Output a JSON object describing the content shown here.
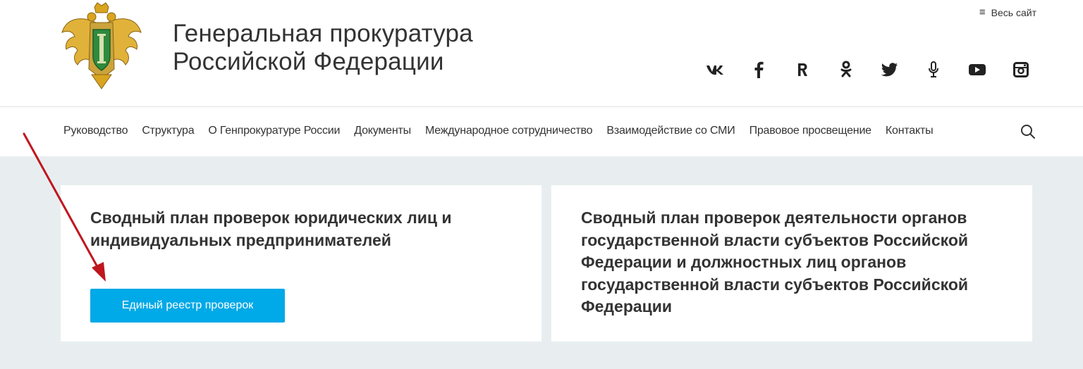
{
  "header": {
    "title_line1": "Генеральная прокуратура",
    "title_line2": "Российской Федерации",
    "all_site_label": "Весь сайт",
    "all_site_icon": "menu-icon"
  },
  "social": [
    {
      "name": "vk",
      "glyph": "VK"
    },
    {
      "name": "facebook",
      "glyph": "f"
    },
    {
      "name": "rutube",
      "glyph": "R"
    },
    {
      "name": "odnoklassniki",
      "glyph": "ok"
    },
    {
      "name": "twitter",
      "glyph": "bird"
    },
    {
      "name": "podcast",
      "glyph": "mic"
    },
    {
      "name": "youtube",
      "glyph": "play"
    },
    {
      "name": "instagram",
      "glyph": "camera"
    }
  ],
  "nav": {
    "items": [
      "Руководство",
      "Структура",
      "О Генпрокуратуре России",
      "Документы",
      "Международное сотрудничество",
      "Взаимодействие со СМИ",
      "Правовое просвещение",
      "Контакты"
    ],
    "search_icon": "search-icon"
  },
  "cards": [
    {
      "title": "Сводный план проверок юридических лиц и индивидуальных предпринимателей",
      "button_label": "Единый реестр проверок"
    },
    {
      "title": "Сводный план проверок деятельности органов государственной власти субъектов Российской Федерации и должностных лиц органов государственной власти субъектов Российской Федерации"
    }
  ],
  "colors": {
    "accent": "#00a9e7",
    "content_bg": "#e8eef0",
    "annotation_arrow": "#c0161e"
  }
}
